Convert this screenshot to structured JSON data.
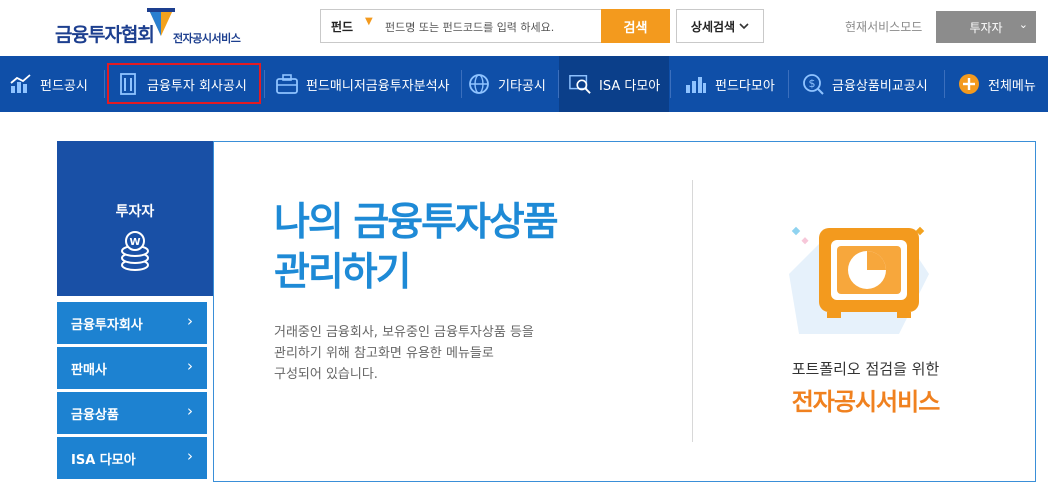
{
  "header": {
    "logo_main": "금융투자협회",
    "logo_sub": "전자공시서비스",
    "search": {
      "category": "펀드",
      "placeholder": "펀드명 또는 펀드코드를 입력 하세요.",
      "button": "검색"
    },
    "advanced_search": "상세검색",
    "mode_label": "현재서비스모드",
    "mode_value": "투자자"
  },
  "nav": {
    "items": [
      {
        "label": "펀드공시",
        "icon": "bar-chart-icon"
      },
      {
        "label": "금융투자 회사공시",
        "icon": "building-icon"
      },
      {
        "label": "펀드매니저금융투자분석사",
        "icon": "briefcase-icon"
      },
      {
        "label": "기타공시",
        "icon": "globe-icon"
      },
      {
        "label": "ISA 다모아",
        "icon": "magnifier-icon"
      },
      {
        "label": "펀드다모아",
        "icon": "bars-icon"
      },
      {
        "label": "금융상품비교공시",
        "icon": "dollar-icon"
      },
      {
        "label": "전체메뉴",
        "icon": "plus-circle-icon"
      }
    ]
  },
  "sidebar": {
    "title": "투자자",
    "items": [
      {
        "label": "금융투자회사"
      },
      {
        "label": "판매사"
      },
      {
        "label": "금융상품"
      },
      {
        "label": "ISA 다모아"
      }
    ]
  },
  "main": {
    "headline_line1": "나의 금융투자상품",
    "headline_line2": "관리하기",
    "desc_line1": "거래중인 금융회사, 보유중인 금융투자상품 등을",
    "desc_line2": "관리하기 위해 참고화면 유용한 메뉴들로",
    "desc_line3": "구성되어 있습니다.",
    "promo_sub": "포트폴리오 점검을 위한",
    "promo_main": "전자공시서비스"
  },
  "colors": {
    "nav_bg": "#0f4fa8",
    "accent_orange": "#f39a1e",
    "headline_blue": "#1e8ad6",
    "highlight_red": "#e31b23"
  }
}
